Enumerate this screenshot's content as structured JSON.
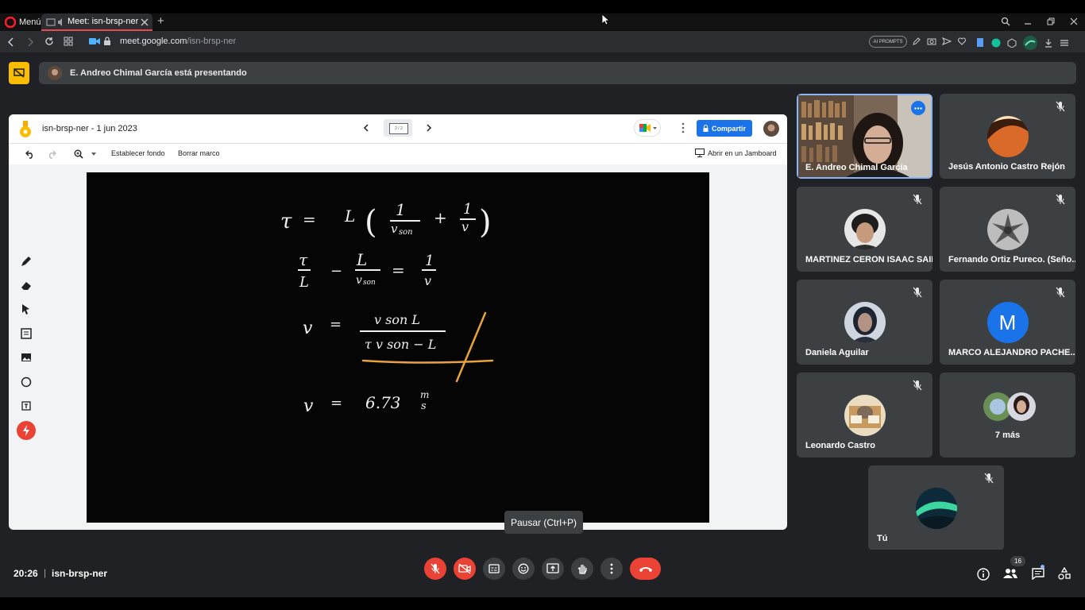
{
  "browser": {
    "menu_label": "Menú",
    "tab_title": "Meet: isn-brsp-ner",
    "new_tab_symbol": "+",
    "url_domain": "meet.google.com",
    "url_path": "/isn-brsp-ner",
    "ai_prompts_label": "AI PROMPTS",
    "window_controls": [
      "search-icon",
      "minimize-icon",
      "restore-icon",
      "close-icon"
    ]
  },
  "banner": {
    "presenter_text": "E. Andreo Chimal García está presentando"
  },
  "jamboard": {
    "title": "isn-brsp-ner - 1 jun 2023",
    "frame_counter": "2 / 2",
    "share_label": "Compartir",
    "set_background_label": "Establecer fondo",
    "clear_frame_label": "Borrar marco",
    "open_jamboard_label": "Abrir en un Jamboard",
    "accent_color": "#1a73e8",
    "math": {
      "line1": "τ = L ( 1/v_son + 1/v )",
      "line2": "τ/L − 1/v_son = 1/v",
      "line3": "v = v_son L / (τ v_son − L)",
      "line4": "v = 6.73 m/s"
    },
    "math_glyphs": {
      "tau": "τ",
      "eq": "=",
      "L": "L",
      "one": "1",
      "vson": "v",
      "son_sub": "son",
      "plus": "+",
      "v": "v",
      "minus": "−",
      "l1_paren_open": "(",
      "l1_paren_close": ")",
      "l3_num": "v son L",
      "l3_den": "τ v son − L",
      "l4_value": "6.73",
      "l4_unit_top": "m",
      "l4_unit_bot": "s"
    },
    "highlight_color": "#e8a33c"
  },
  "participants": [
    {
      "name": "E. Andreo Chimal García",
      "type": "video",
      "active": true
    },
    {
      "name": "Jesús Antonio Castro Rejón",
      "type": "avatar"
    },
    {
      "name": "MARTINEZ CERON ISAAC SAID",
      "type": "avatar"
    },
    {
      "name": "Fernando Ortiz Pureco. (Seño...",
      "type": "avatar"
    },
    {
      "name": "Daniela Aguilar",
      "type": "avatar"
    },
    {
      "name": "MARCO ALEJANDRO PACHE...",
      "type": "letter",
      "letter": "M",
      "color": "#1a73e8"
    },
    {
      "name": "Leonardo Castro",
      "type": "avatar"
    },
    {
      "name": "7 más",
      "type": "more"
    },
    {
      "name": "Tú",
      "type": "avatar"
    }
  ],
  "bottom_bar": {
    "time": "20:26",
    "separator": "|",
    "meeting_code": "isn-brsp-ner",
    "participant_count": "16",
    "tooltip": "Pausar (Ctrl+P)",
    "end_call_color": "#ea4335"
  }
}
